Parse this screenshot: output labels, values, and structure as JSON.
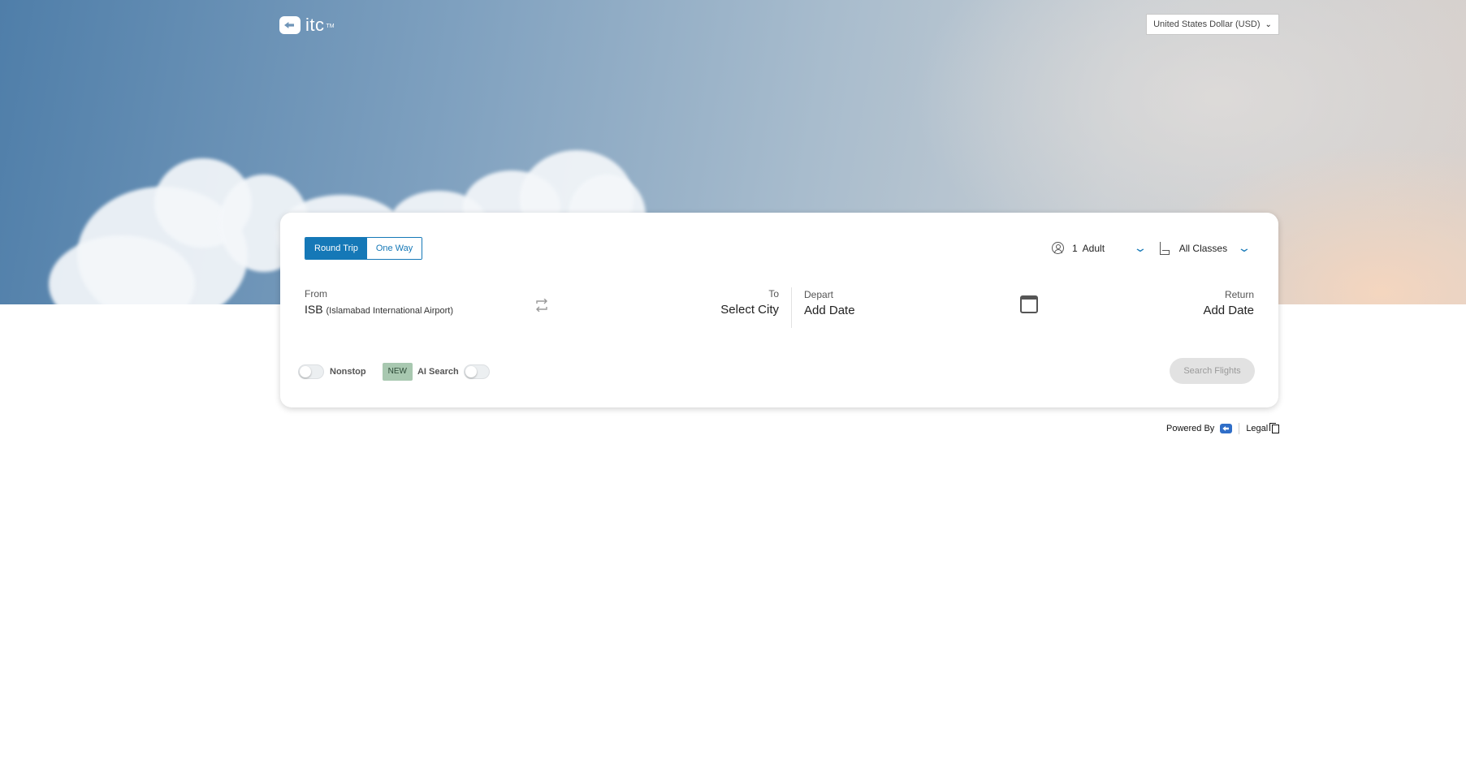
{
  "header": {
    "logo_text": "itc",
    "logo_tm": "TM",
    "currency": "United States Dollar (USD)"
  },
  "search": {
    "trip_types": [
      "Round Trip",
      "One Way"
    ],
    "selected_trip": "Round Trip",
    "travellers": "1  Adult",
    "cabin_class": "All Classes",
    "from_label": "From",
    "from_code": "ISB",
    "from_airport": "(Islamabad International Airport)",
    "to_label": "To",
    "to_value": "Select City",
    "depart_label": "Depart",
    "depart_value": "Add Date",
    "return_label": "Return",
    "return_value": "Add Date",
    "nonstop_label": "Nonstop",
    "new_badge": "NEW",
    "ai_search_label": "AI Search",
    "search_button": "Search Flights"
  },
  "footer": {
    "powered_by": "Powered By",
    "legal": "Legal"
  },
  "colors": {
    "accent": "#1578b7",
    "badge": "#a8c8b0",
    "disabled_button": "#e2e2e2"
  },
  "icons": [
    "logo-icon",
    "chevron-down-icon",
    "person-icon",
    "seat-icon",
    "swap-icon",
    "calendar-icon",
    "powered-by-logo-icon",
    "document-icon"
  ]
}
